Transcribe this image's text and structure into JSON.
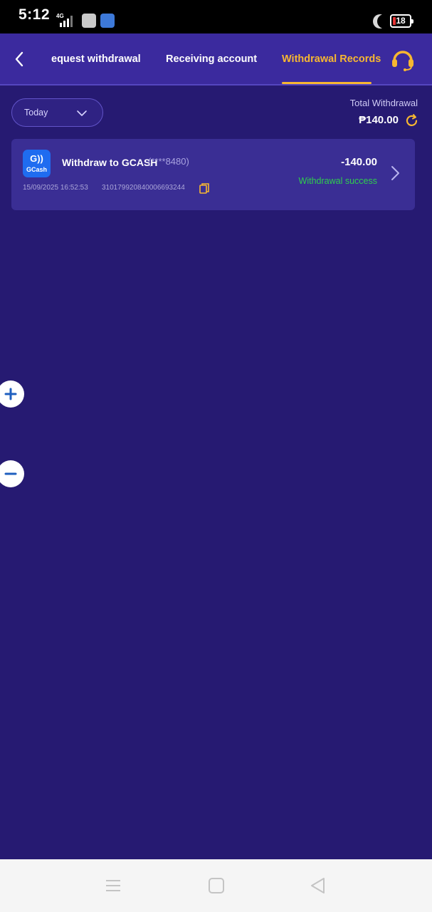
{
  "status_bar": {
    "time": "5:12",
    "network": "4G",
    "battery": "18",
    "icons": [
      "signal-icon",
      "app-notification-icon",
      "app-notification-icon",
      "do-not-disturb-moon-icon",
      "battery-icon"
    ]
  },
  "header": {
    "tabs": [
      {
        "label": "equest withdrawal",
        "active": false
      },
      {
        "label": "Receiving account",
        "active": false
      },
      {
        "label": "Withdrawal Records",
        "active": true
      }
    ],
    "accent_color": "#f7b731"
  },
  "filter": {
    "selected": "Today"
  },
  "summary": {
    "label": "Total Withdrawal",
    "amount": "₱140.00"
  },
  "records": [
    {
      "title": "Withdraw to GCASH",
      "account": "(****8480)",
      "datetime": "15/09/2025 16:52:53",
      "transaction_id": "31017992084000669324​4",
      "amount": "-140.00",
      "status": "Withdrawal success",
      "status_color": "#2fcf4c",
      "provider_logo_text": "G))",
      "provider_name": "GCash"
    }
  ],
  "colors": {
    "background": "#261a72",
    "header": "#3b2a9e",
    "card": "#3a2e94"
  }
}
